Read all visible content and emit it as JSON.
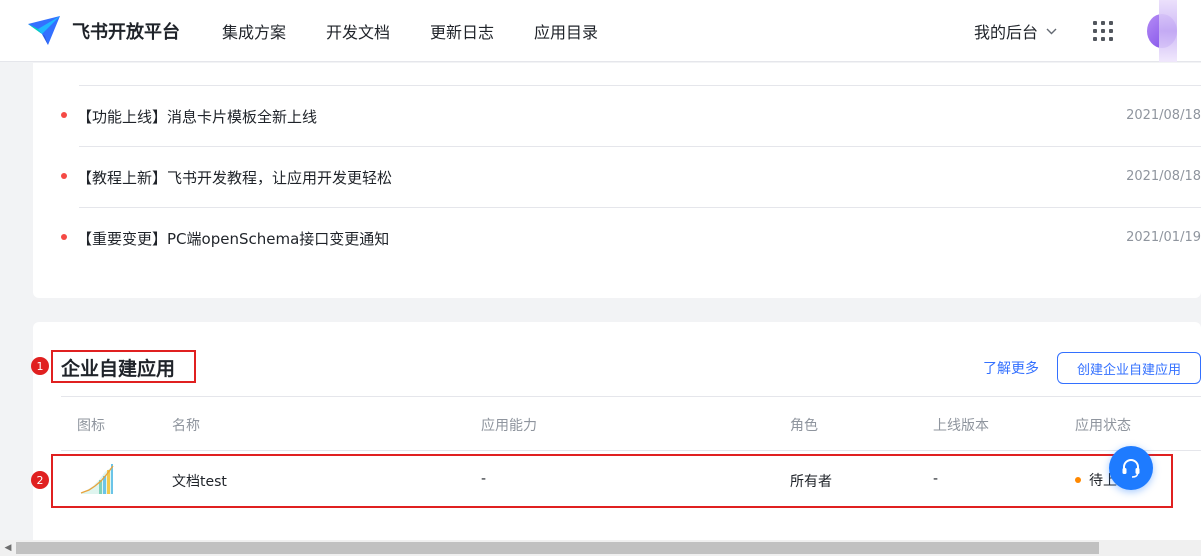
{
  "header": {
    "logo_title": "飞书开放平台",
    "nav": [
      "集成方案",
      "开发文档",
      "更新日志",
      "应用目录"
    ],
    "console": "我的后台"
  },
  "news": [
    {
      "title": "【功能上线】消息卡片模板全新上线",
      "date": "2021/08/18"
    },
    {
      "title": "【教程上新】飞书开发教程，让应用开发更轻松",
      "date": "2021/08/18"
    },
    {
      "title": "【重要变更】PC端openSchema接口变更通知",
      "date": "2021/01/19"
    }
  ],
  "apps_section": {
    "title": "企业自建应用",
    "learn_more": "了解更多",
    "create_button": "创建企业自建应用",
    "columns": [
      "图标",
      "名称",
      "应用能力",
      "角色",
      "上线版本",
      "应用状态"
    ],
    "rows": [
      {
        "name": "文档test",
        "capability": "-",
        "role": "所有者",
        "version": "-",
        "status": "待上线"
      }
    ]
  },
  "annotations": [
    "1",
    "2"
  ],
  "colors": {
    "accent": "#3370ff",
    "annotation": "#e02020",
    "news_dot": "#f54a45",
    "status_dot": "#ff8800",
    "help_button": "#1e7bff"
  },
  "icons": [
    "feishu-logo-icon",
    "chevron-down-icon",
    "apps-grid-icon",
    "headset-icon",
    "scroll-left-arrow-icon"
  ]
}
